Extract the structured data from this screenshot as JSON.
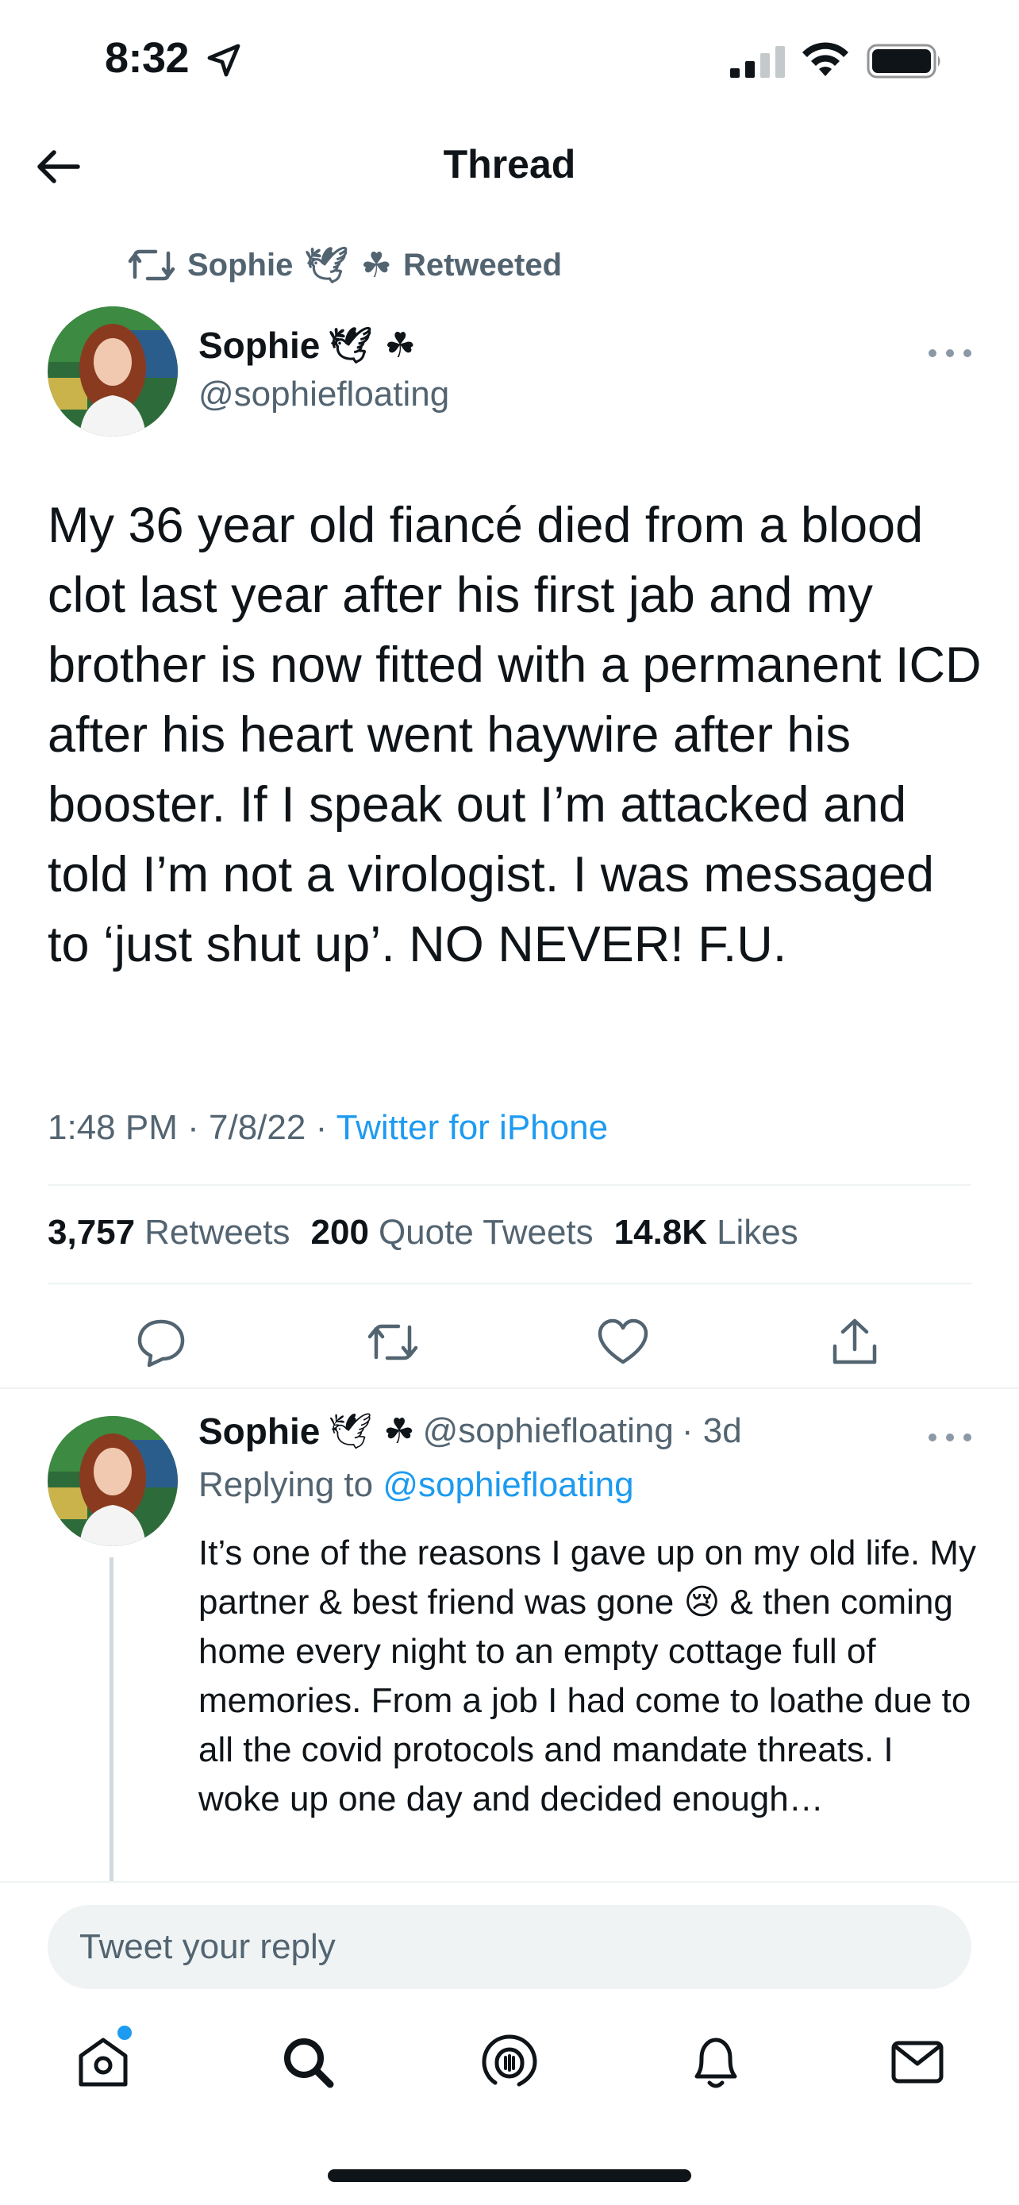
{
  "status_bar": {
    "time": "8:32"
  },
  "header": {
    "title": "Thread"
  },
  "retweet_banner": {
    "name": "Sophie",
    "emojis": "🕊 ☘",
    "action": "Retweeted"
  },
  "tweet": {
    "author_name": "Sophie",
    "author_emojis": "🕊 ☘",
    "handle": "@sophiefloating",
    "text": "My 36 year old fiancé died from a blood clot last year after his first jab and my brother is now fitted with a permanent ICD after his heart went haywire after his booster. If I speak out I’m attacked and told I’m not a virologist. I was messaged to ‘just shut up’. NO NEVER! F.U.",
    "time": "1:48 PM",
    "date": "7/8/22",
    "separator": "·",
    "source": "Twitter for iPhone",
    "stats": {
      "retweets_count": "3,757",
      "retweets_label": "Retweets",
      "quotes_count": "200",
      "quotes_label": "Quote Tweets",
      "likes_count": "14.8K",
      "likes_label": "Likes"
    }
  },
  "reply": {
    "author_name": "Sophie",
    "author_emojis": "🕊 ☘",
    "handle": "@sophiefloating",
    "age": "· 3d",
    "replying_prefix": "Replying to",
    "replying_handle": "@sophiefloating",
    "text": "It’s one of the reasons I gave up on my old life. My partner & best friend was gone 😢 & then coming home every night to an empty cottage full of memories. From a job I had come to loathe due to all the covid protocols and mandate threats. I woke up one day and decided enough…"
  },
  "compose": {
    "placeholder": "Tweet your reply"
  },
  "colors": {
    "accent": "#1d9bf0",
    "secondary_text": "#536471",
    "divider": "#eff3f4"
  },
  "icons": {
    "header": [
      "arrow-left-icon"
    ],
    "actions": [
      "reply-icon",
      "retweet-icon",
      "like-icon",
      "share-icon"
    ],
    "tabs": [
      "home-icon",
      "search-icon",
      "spaces-icon",
      "notifications-icon",
      "messages-icon"
    ]
  }
}
